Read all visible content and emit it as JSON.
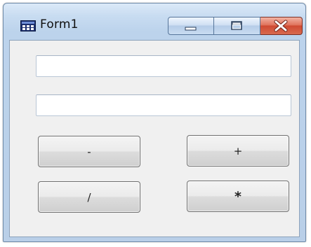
{
  "window": {
    "title": "Form1"
  },
  "caption_buttons": {
    "minimize_icon": "minimize-icon",
    "maximize_icon": "maximize-icon",
    "close_icon": "close-icon"
  },
  "inputs": {
    "first_value": "",
    "second_value": ""
  },
  "buttons": {
    "subtract_label": "-",
    "add_label": "+",
    "divide_label": "/",
    "multiply_label": "*"
  },
  "colors": {
    "frame": "#b9cfe8",
    "close_button": "#cf4a32",
    "client_background": "#f0f0f0"
  }
}
